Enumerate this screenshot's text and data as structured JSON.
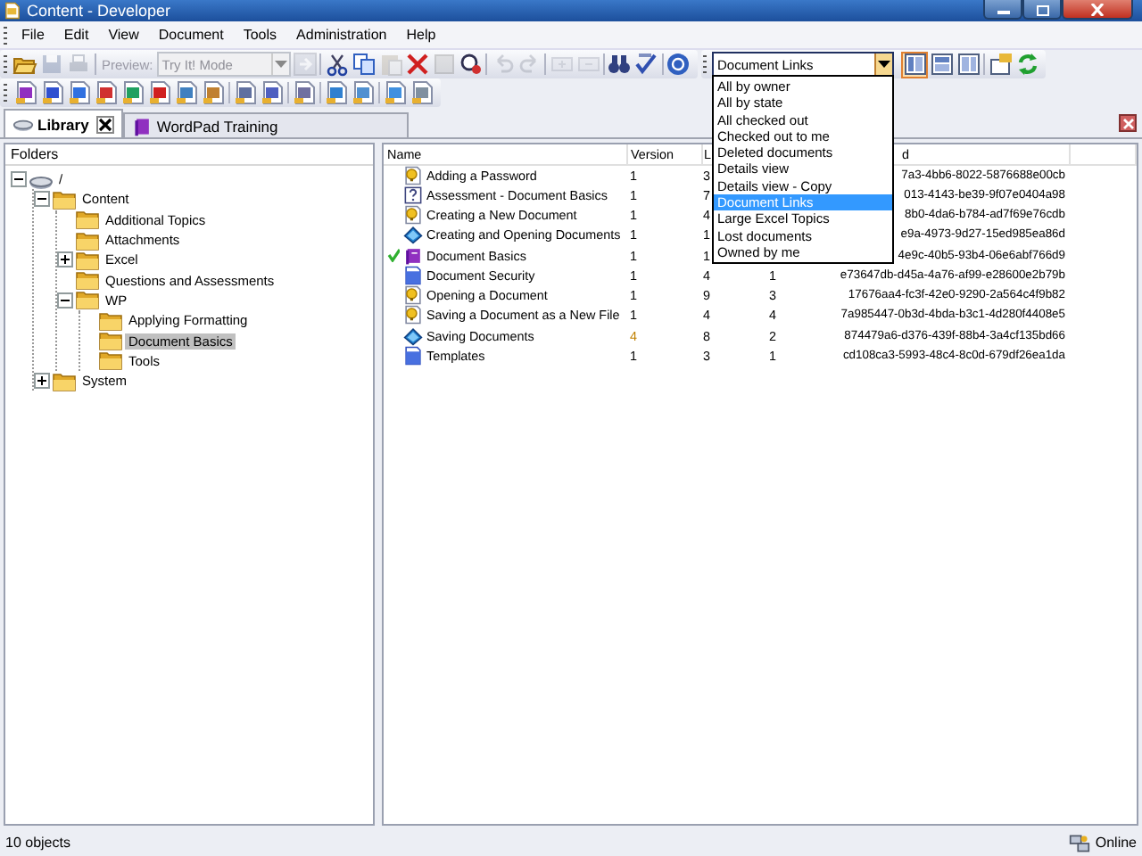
{
  "window": {
    "title": "Content - Developer"
  },
  "menu": [
    "File",
    "Edit",
    "View",
    "Document",
    "Tools",
    "Administration",
    "Help"
  ],
  "toolbar_1": [
    {
      "kind": "open",
      "disabled": false
    },
    {
      "kind": "save",
      "disabled": true
    },
    {
      "kind": "print",
      "disabled": true
    },
    {
      "kind": "separator"
    },
    {
      "kind": "label",
      "text": "Preview:",
      "disabled": true
    },
    {
      "kind": "combo",
      "value": "Try It! Mode",
      "disabled": true
    },
    {
      "kind": "go",
      "disabled": true
    },
    {
      "kind": "separator"
    },
    {
      "kind": "cut",
      "disabled": false
    },
    {
      "kind": "copy",
      "disabled": false
    },
    {
      "kind": "paste",
      "disabled": true
    },
    {
      "kind": "delete",
      "disabled": false
    },
    {
      "kind": "properties",
      "disabled": true
    },
    {
      "kind": "find",
      "disabled": false
    },
    {
      "kind": "separator"
    },
    {
      "kind": "undo",
      "disabled": true
    },
    {
      "kind": "redo",
      "disabled": true
    },
    {
      "kind": "separator"
    },
    {
      "kind": "link",
      "disabled": true
    },
    {
      "kind": "unlink",
      "disabled": true
    },
    {
      "kind": "separator"
    },
    {
      "kind": "binoculars",
      "disabled": false
    },
    {
      "kind": "spell",
      "disabled": false
    },
    {
      "kind": "separator"
    },
    {
      "kind": "help",
      "disabled": false
    }
  ],
  "view_toolbar": {
    "combo_value": "Document Links",
    "options": [
      {
        "label": "All by owner",
        "selected": false
      },
      {
        "label": "All by state",
        "selected": false
      },
      {
        "label": "All checked out",
        "selected": false
      },
      {
        "label": "Checked out to me",
        "selected": false
      },
      {
        "label": "Deleted documents",
        "selected": false
      },
      {
        "label": "Details view",
        "selected": false
      },
      {
        "label": "Details view - Copy",
        "selected": false
      },
      {
        "label": "Document Links",
        "selected": true
      },
      {
        "label": "Large Excel Topics",
        "selected": false
      },
      {
        "label": "Lost documents",
        "selected": false
      },
      {
        "label": "Owned by me",
        "selected": false
      }
    ],
    "buttons": [
      {
        "kind": "layout-a",
        "selected": true
      },
      {
        "kind": "layout-b",
        "selected": false
      },
      {
        "kind": "layout-c",
        "selected": false
      },
      {
        "kind": "separator"
      },
      {
        "kind": "export",
        "selected": false
      },
      {
        "kind": "refresh",
        "selected": false
      }
    ]
  },
  "toolbar_2": [
    {
      "kind": "doc",
      "color": "#9030c0"
    },
    {
      "kind": "doc",
      "color": "#3050d0"
    },
    {
      "kind": "doc",
      "color": "#3070e0"
    },
    {
      "kind": "doc",
      "color": "#d03030"
    },
    {
      "kind": "doc",
      "color": "#20a060"
    },
    {
      "kind": "doc",
      "color": "#d02020"
    },
    {
      "kind": "doc",
      "color": "#4080c0"
    },
    {
      "kind": "doc",
      "color": "#c08030"
    },
    {
      "kind": "separator"
    },
    {
      "kind": "doc",
      "color": "#6070a0"
    },
    {
      "kind": "doc",
      "color": "#5060c0"
    },
    {
      "kind": "separator"
    },
    {
      "kind": "doc",
      "color": "#7070a0"
    },
    {
      "kind": "separator"
    },
    {
      "kind": "doc",
      "color": "#3080d0"
    },
    {
      "kind": "doc",
      "color": "#5090d0"
    },
    {
      "kind": "separator"
    },
    {
      "kind": "doc",
      "color": "#4090e0"
    },
    {
      "kind": "doc",
      "color": "#8090a0"
    }
  ],
  "tabs": [
    {
      "label": "Library",
      "selected": true,
      "closable": true
    },
    {
      "label": "WordPad Training",
      "selected": false,
      "closable": false
    }
  ],
  "folders": {
    "title": "Folders",
    "tree": [
      {
        "label": "/",
        "kind": "root",
        "expanded": true,
        "children": [
          {
            "label": "Content",
            "expanded": true,
            "selected": false,
            "children": [
              {
                "label": "Additional Topics",
                "selected": false
              },
              {
                "label": "Attachments",
                "selected": false
              },
              {
                "label": "Excel",
                "expanded": false,
                "selected": false
              },
              {
                "label": "Questions and Assessments",
                "selected": false
              },
              {
                "label": "WP",
                "expanded": true,
                "selected": false,
                "children": [
                  {
                    "label": "Applying Formatting",
                    "selected": false
                  },
                  {
                    "label": "Document Basics",
                    "selected": true
                  },
                  {
                    "label": "Tools",
                    "selected": false
                  }
                ]
              }
            ]
          },
          {
            "label": "System",
            "expanded": false,
            "selected": false
          }
        ]
      }
    ]
  },
  "table": {
    "columns": [
      "Name",
      "Version",
      "L",
      "d"
    ],
    "rows": [
      {
        "kind": "topic",
        "checked_out": false,
        "changed": false,
        "name": "Adding a Password",
        "version": "1",
        "column_3": "3",
        "column_4": "",
        "column_5": "7a3-4bb6-8022-5876688e00cb"
      },
      {
        "kind": "assessment",
        "checked_out": false,
        "changed": false,
        "name": "Assessment - Document Basics",
        "version": "1",
        "column_3": "7",
        "column_4": "",
        "column_5": "013-4143-be39-9f07e0404a98"
      },
      {
        "kind": "topic",
        "checked_out": false,
        "changed": false,
        "name": "Creating a New Document",
        "version": "1",
        "column_3": "4",
        "column_4": "",
        "column_5": "8b0-4da6-b784-ad7f69e76cdb"
      },
      {
        "kind": "section",
        "checked_out": false,
        "changed": false,
        "name": "Creating and Opening Documents",
        "version": "1",
        "column_3": "1",
        "column_4": "",
        "column_5": "e9a-4973-9d27-15ed985ea86d"
      },
      {
        "kind": "module",
        "checked_out": true,
        "changed": false,
        "name": "Document Basics",
        "version": "1",
        "column_3": "1",
        "column_4": "",
        "column_5": "4e9c-40b5-93b4-06e6abf766d9"
      },
      {
        "kind": "page",
        "checked_out": false,
        "changed": false,
        "name": "Document Security",
        "version": "1",
        "column_3": "4",
        "column_4": "1",
        "column_5": "e73647db-d45a-4a76-af99-e28600e2b79b"
      },
      {
        "kind": "topic",
        "checked_out": false,
        "changed": false,
        "name": "Opening a Document",
        "version": "1",
        "column_3": "9",
        "column_4": "3",
        "column_5": "17676aa4-fc3f-42e0-9290-2a564c4f9b82"
      },
      {
        "kind": "topic",
        "checked_out": false,
        "changed": false,
        "name": "Saving a Document as a New File",
        "version": "1",
        "column_3": "4",
        "column_4": "4",
        "column_5": "7a985447-0b3d-4bda-b3c1-4d280f4408e5"
      },
      {
        "kind": "section",
        "checked_out": false,
        "changed": true,
        "name": "Saving Documents",
        "version": "4",
        "column_3": "8",
        "column_4": "2",
        "column_5": "874479a6-d376-439f-88b4-3a4cf135bd66"
      },
      {
        "kind": "page",
        "checked_out": false,
        "changed": false,
        "name": "Templates",
        "version": "1",
        "column_3": "3",
        "column_4": "1",
        "column_5": "cd108ca3-5993-48c4-8c0d-679df26ea1da"
      }
    ]
  },
  "status_bar": {
    "count": "10 objects",
    "connection": "Online"
  }
}
